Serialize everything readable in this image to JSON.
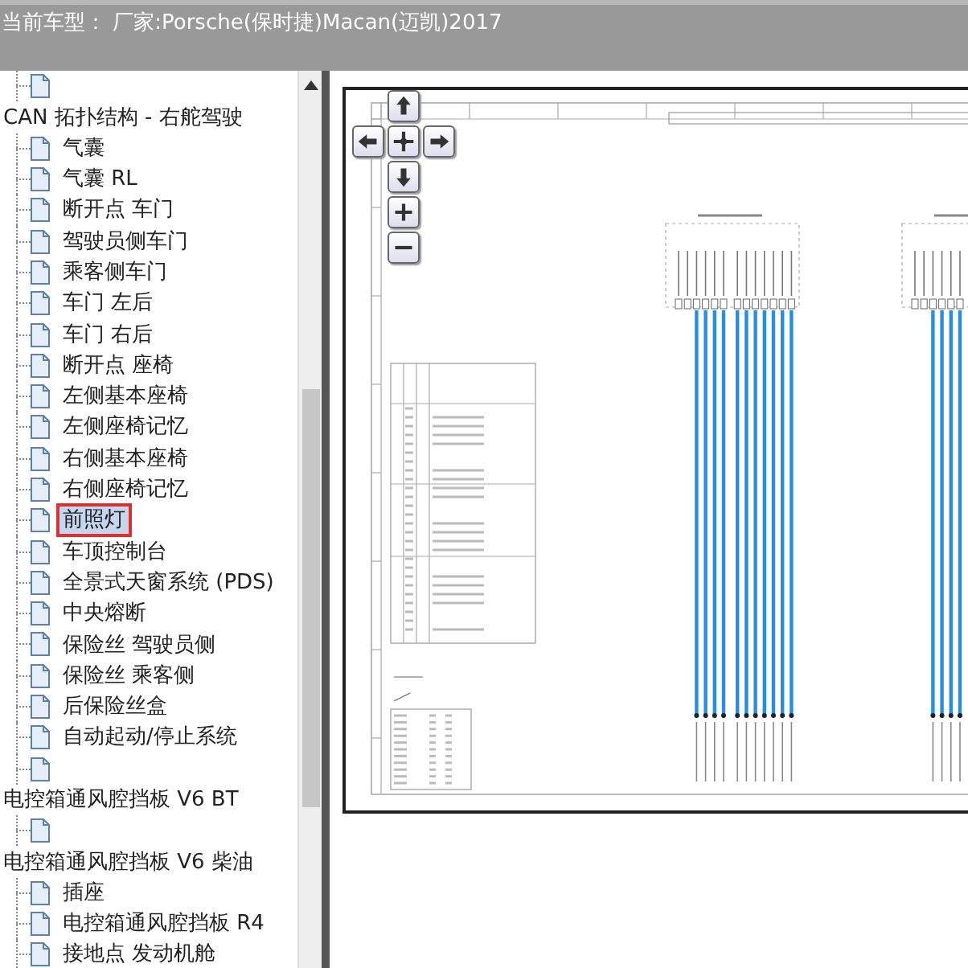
{
  "header": {
    "title": "当前车型： 厂家:Porsche(保时捷)Macan(迈凯)2017"
  },
  "tree": [
    {
      "children": [
        {
          "selected": false
        }
      ]
    },
    {
      "label": "CAN 拓扑结构 - 右舵驾驶",
      "children": [
        {
          "label": "气囊",
          "selected": false
        },
        {
          "label": "气囊 RL",
          "selected": false
        },
        {
          "label": "断开点 车门",
          "selected": false
        },
        {
          "label": "驾驶员侧车门",
          "selected": false
        },
        {
          "label": "乘客侧车门",
          "selected": false
        },
        {
          "label": "车门 左后",
          "selected": false
        },
        {
          "label": "车门 右后",
          "selected": false
        },
        {
          "label": "断开点 座椅",
          "selected": false
        },
        {
          "label": "左侧基本座椅",
          "selected": false
        },
        {
          "label": "左侧座椅记忆",
          "selected": false
        },
        {
          "label": "右侧基本座椅",
          "selected": false
        },
        {
          "label": "右侧座椅记忆",
          "selected": false
        },
        {
          "label": "前照灯",
          "selected": true
        },
        {
          "label": "车顶控制台",
          "selected": false
        },
        {
          "label": "全景式天窗系统 (PDS)",
          "selected": false
        },
        {
          "label": "中央熔断",
          "selected": false
        },
        {
          "label": "保险丝 驾驶员侧",
          "selected": false
        },
        {
          "label": "保险丝 乘客侧",
          "selected": false
        },
        {
          "label": "后保险丝盒",
          "selected": false
        },
        {
          "label": "自动起动/停止系统",
          "selected": false
        },
        {
          "selected": false
        }
      ]
    },
    {
      "label": "电控箱通风腔挡板 V6 BT",
      "children": [
        {
          "selected": false
        }
      ]
    },
    {
      "label": "电控箱通风腔挡板 V6 柴油",
      "children": [
        {
          "label": "插座",
          "selected": false
        },
        {
          "label": "电控箱通风腔挡板 R4",
          "selected": false
        },
        {
          "label": "接地点 发动机舱",
          "selected": false
        }
      ]
    }
  ]
}
